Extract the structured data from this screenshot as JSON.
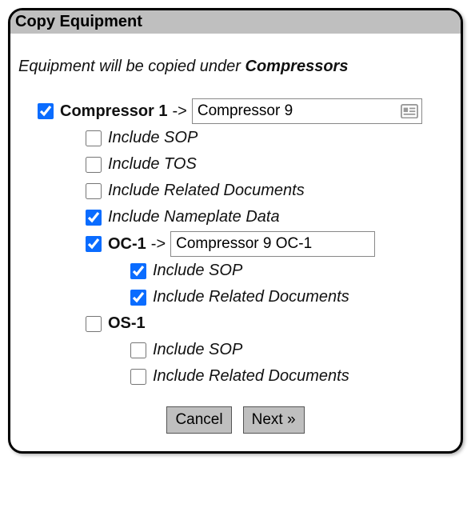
{
  "title": "Copy Equipment",
  "intro": {
    "prefix": "Equipment will be copied under ",
    "destination": "Compressors"
  },
  "items": [
    {
      "checked": true,
      "name": "Compressor 1",
      "target": "Compressor 9",
      "has_card_icon": true,
      "options": [
        {
          "checked": false,
          "label": "Include SOP"
        },
        {
          "checked": false,
          "label": "Include TOS"
        },
        {
          "checked": false,
          "label": "Include Related Documents"
        },
        {
          "checked": true,
          "label": "Include Nameplate Data"
        }
      ],
      "children": [
        {
          "checked": true,
          "name": "OC-1",
          "target": "Compressor 9 OC-1",
          "options": [
            {
              "checked": true,
              "label": "Include SOP"
            },
            {
              "checked": true,
              "label": "Include Related Documents"
            }
          ]
        },
        {
          "checked": false,
          "name": "OS-1",
          "target": null,
          "options": [
            {
              "checked": false,
              "label": "Include SOP"
            },
            {
              "checked": false,
              "label": "Include Related Documents"
            }
          ]
        }
      ]
    }
  ],
  "buttons": {
    "cancel": "Cancel",
    "next": "Next »"
  },
  "arrow_suffix": "->"
}
